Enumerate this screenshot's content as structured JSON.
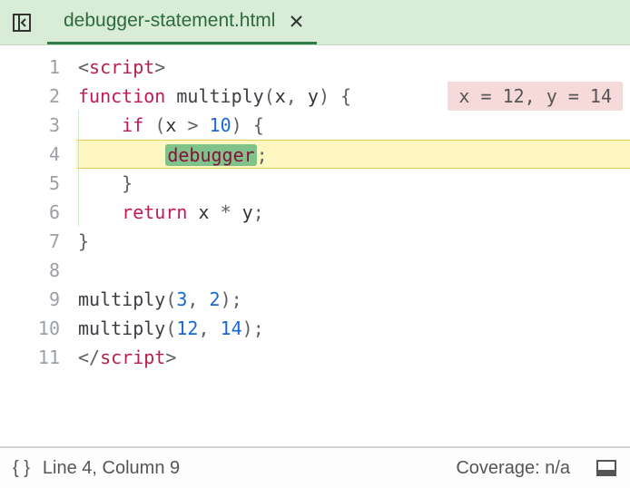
{
  "tabs": [
    {
      "label": "debugger-statement.html",
      "active": true
    }
  ],
  "editor": {
    "highlight_line": 4,
    "inline_values": {
      "line": 2,
      "text": "x = 12, y = 14"
    },
    "lines": [
      {
        "n": 1,
        "tokens": [
          [
            "punct",
            "<"
          ],
          [
            "tag",
            "script"
          ],
          [
            "punct",
            ">"
          ]
        ]
      },
      {
        "n": 2,
        "tokens": [
          [
            "kw",
            "function"
          ],
          [
            "plain",
            " "
          ],
          [
            "fn",
            "multiply"
          ],
          [
            "punct",
            "("
          ],
          [
            "var",
            "x"
          ],
          [
            "punct",
            ", "
          ],
          [
            "var",
            "y"
          ],
          [
            "punct",
            ") {"
          ]
        ]
      },
      {
        "n": 3,
        "guide": true,
        "tokens": [
          [
            "plain",
            "    "
          ],
          [
            "kw",
            "if"
          ],
          [
            "plain",
            " "
          ],
          [
            "punct",
            "("
          ],
          [
            "var",
            "x"
          ],
          [
            "plain",
            " "
          ],
          [
            "punct",
            ">"
          ],
          [
            "plain",
            " "
          ],
          [
            "num",
            "10"
          ],
          [
            "punct",
            ") {"
          ]
        ]
      },
      {
        "n": 4,
        "guide": true,
        "tokens": [
          [
            "plain",
            "        "
          ],
          [
            "deb",
            "debugger"
          ],
          [
            "punct",
            ";"
          ]
        ]
      },
      {
        "n": 5,
        "guide": true,
        "tokens": [
          [
            "plain",
            "    "
          ],
          [
            "punct",
            "}"
          ]
        ]
      },
      {
        "n": 6,
        "guide": true,
        "tokens": [
          [
            "plain",
            "    "
          ],
          [
            "kw",
            "return"
          ],
          [
            "plain",
            " "
          ],
          [
            "var",
            "x"
          ],
          [
            "plain",
            " "
          ],
          [
            "punct",
            "*"
          ],
          [
            "plain",
            " "
          ],
          [
            "var",
            "y"
          ],
          [
            "punct",
            ";"
          ]
        ]
      },
      {
        "n": 7,
        "tokens": [
          [
            "punct",
            "}"
          ]
        ]
      },
      {
        "n": 8,
        "tokens": []
      },
      {
        "n": 9,
        "tokens": [
          [
            "fn",
            "multiply"
          ],
          [
            "punct",
            "("
          ],
          [
            "num",
            "3"
          ],
          [
            "punct",
            ", "
          ],
          [
            "num",
            "2"
          ],
          [
            "punct",
            ");"
          ]
        ]
      },
      {
        "n": 10,
        "tokens": [
          [
            "fn",
            "multiply"
          ],
          [
            "punct",
            "("
          ],
          [
            "num",
            "12"
          ],
          [
            "punct",
            ", "
          ],
          [
            "num",
            "14"
          ],
          [
            "punct",
            ");"
          ]
        ]
      },
      {
        "n": 11,
        "tokens": [
          [
            "punct",
            "</"
          ],
          [
            "tag",
            "script"
          ],
          [
            "punct",
            ">"
          ]
        ]
      }
    ]
  },
  "status": {
    "format_label": "{ }",
    "position": "Line 4, Column 9",
    "coverage": "Coverage: n/a"
  }
}
